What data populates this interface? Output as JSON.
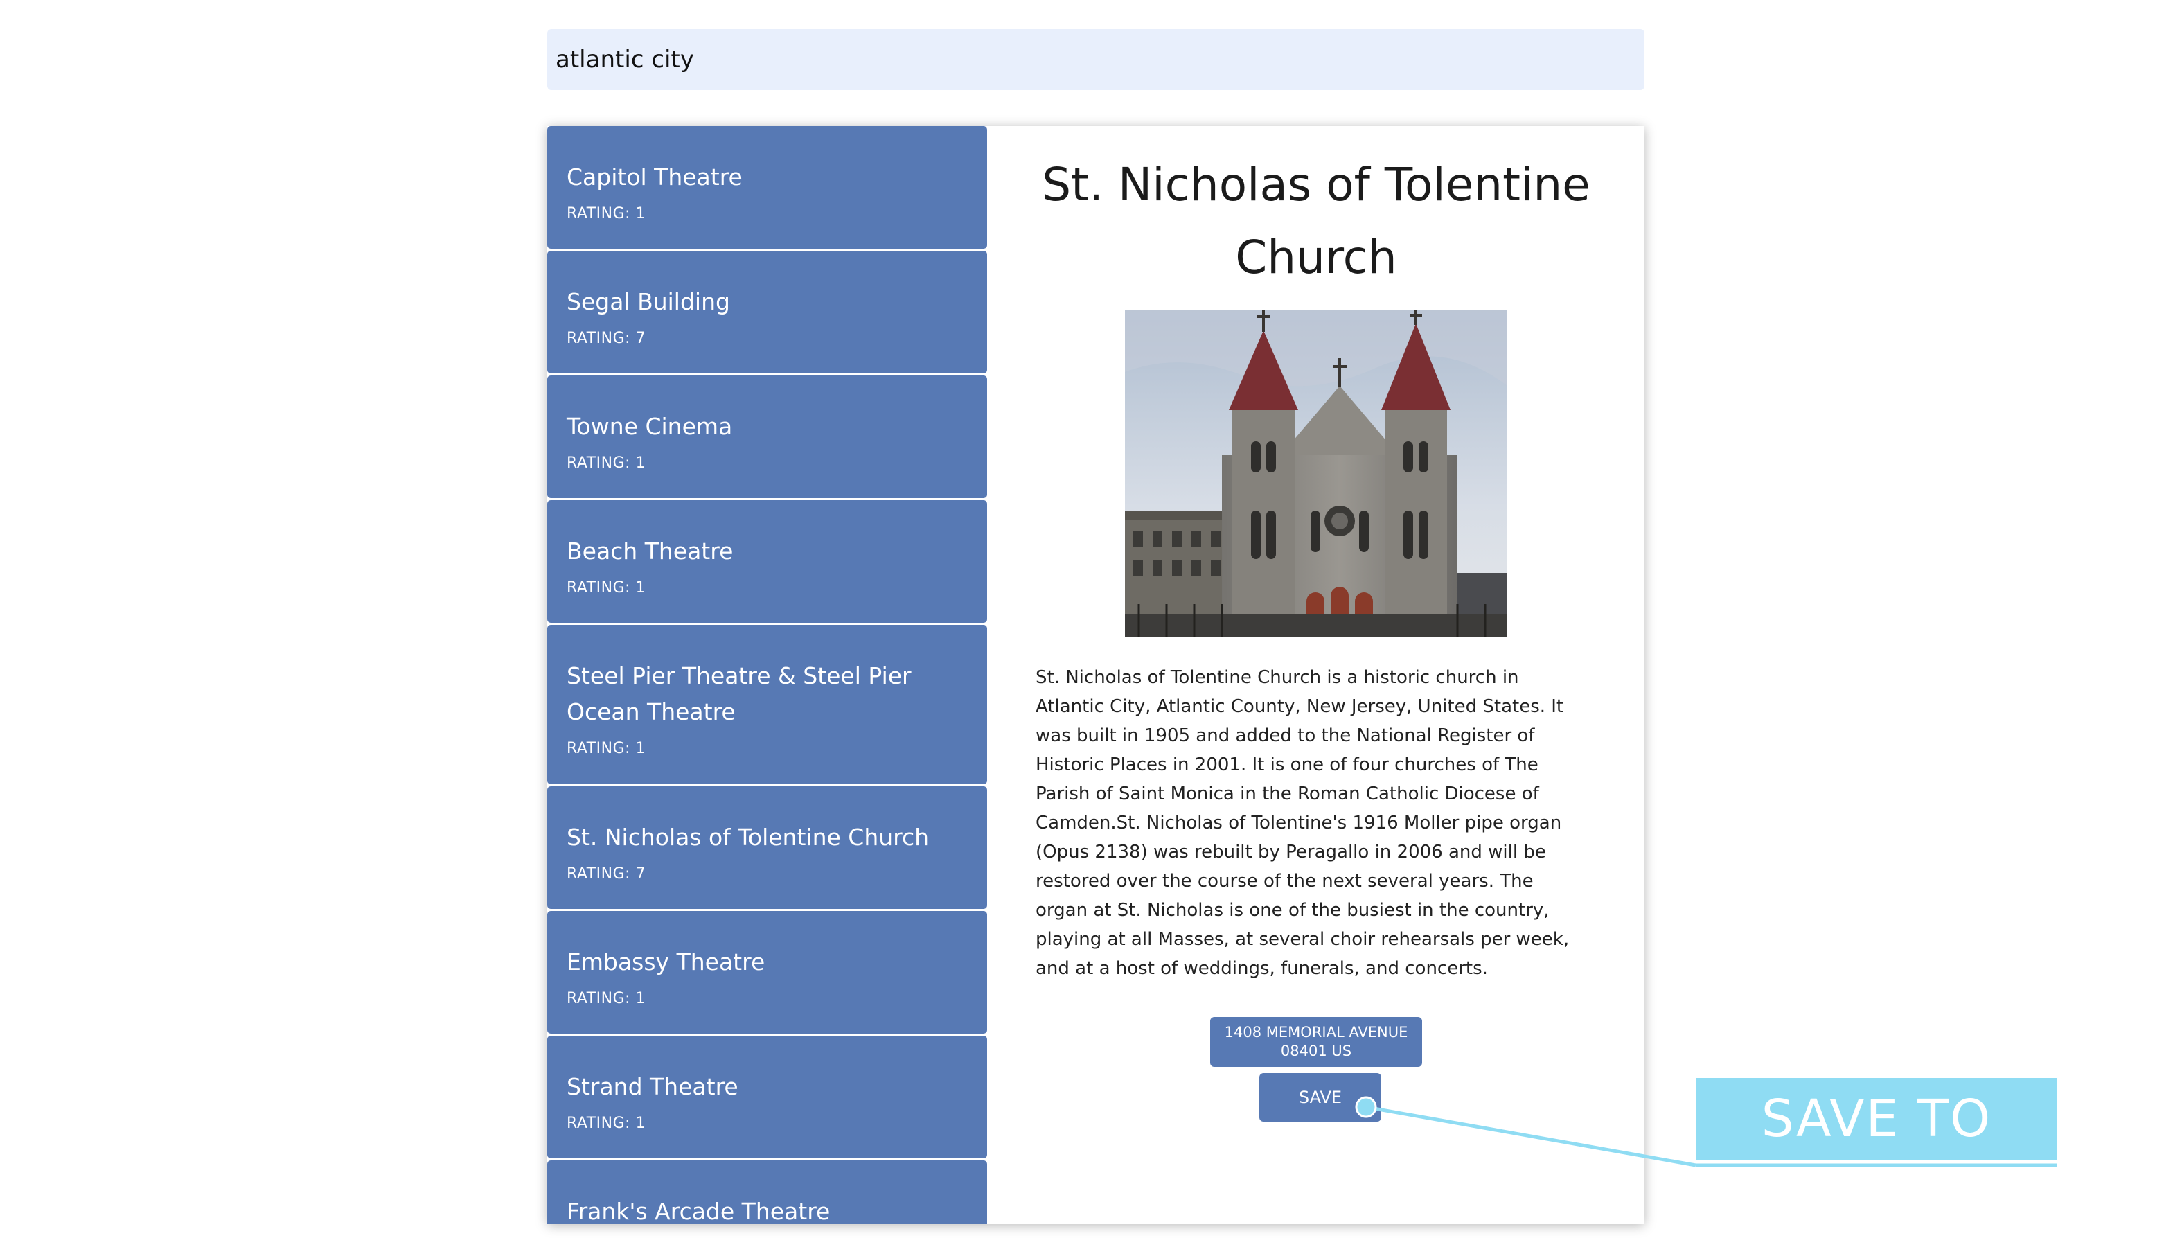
{
  "search": {
    "value": "atlantic city"
  },
  "places": [
    {
      "name": "Capitol Theatre",
      "rating": "RATING: 1"
    },
    {
      "name": "Segal Building",
      "rating": "RATING: 7"
    },
    {
      "name": "Towne Cinema",
      "rating": "RATING: 1"
    },
    {
      "name": "Beach Theatre",
      "rating": "RATING: 1"
    },
    {
      "name": "Steel Pier Theatre & Steel Pier Ocean Theatre",
      "rating": "RATING: 1"
    },
    {
      "name": "St. Nicholas of Tolentine Church",
      "rating": "RATING: 7"
    },
    {
      "name": "Embassy Theatre",
      "rating": "RATING: 1"
    },
    {
      "name": "Strand Theatre",
      "rating": "RATING: 1"
    },
    {
      "name": "Frank's Arcade Theatre",
      "rating": ""
    }
  ],
  "detail": {
    "title": "St. Nicholas of Tolentine Church",
    "description": "St. Nicholas of Tolentine Church is a historic church in Atlantic City, Atlantic County, New Jersey, United States. It was built in 1905 and added to the National Register of Historic Places in 2001. It is one of four churches of The Parish of Saint Monica in the Roman Catholic Diocese of Camden.St. Nicholas of Tolentine's 1916 Moller pipe organ (Opus 2138) was rebuilt by Peragallo in 2006 and will be restored over the course of the next several years. The organ at St. Nicholas is one of the busiest in the country, playing at all Masses, at several choir rehearsals per week, and at a host of weddings, funerals, and concerts.",
    "address_line1": "1408 MEMORIAL AVENUE",
    "address_line2": "08401 US",
    "save_label": "SAVE"
  },
  "annotation": {
    "label": "SAVE TO USER",
    "color": "#8fdcf3"
  },
  "colors": {
    "accent": "#5779b4",
    "search_bg": "#e8effc"
  }
}
